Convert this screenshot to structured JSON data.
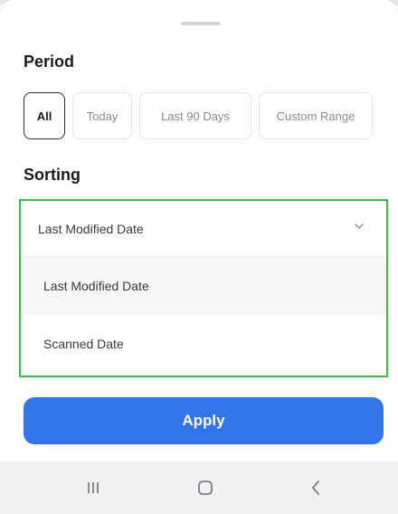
{
  "period": {
    "title": "Period",
    "options": [
      "All",
      "Today",
      "Last 90 Days",
      "Custom Range"
    ],
    "selected": "All"
  },
  "sorting": {
    "title": "Sorting",
    "selected_value": "Last Modified Date",
    "options": [
      "Last Modified Date",
      "Scanned Date"
    ]
  },
  "apply_label": "Apply",
  "icons": {
    "dropdown": "chevron-down-icon",
    "nav_recent": "recent-apps-icon",
    "nav_home": "home-icon",
    "nav_back": "back-icon"
  },
  "colors": {
    "accent": "#3474e9",
    "highlight_border": "#3fb950",
    "nav_bg": "#f1f1f4"
  }
}
